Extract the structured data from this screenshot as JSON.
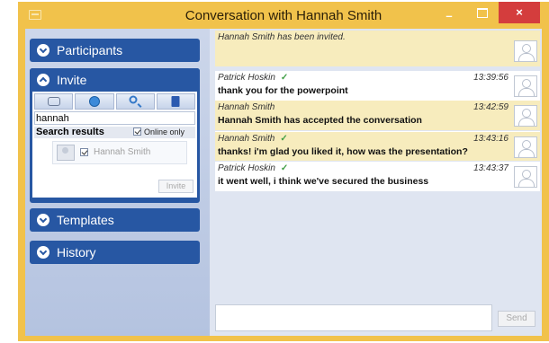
{
  "window": {
    "title": "Conversation with Hannah Smith",
    "minimize": "–",
    "close": "×"
  },
  "sidebar": {
    "participants": "Participants",
    "invite": {
      "title": "Invite",
      "search_value": "hannah",
      "results_label": "Search results",
      "online_only": "Online only",
      "online_only_checked": true,
      "result": {
        "name": "Hannah Smith",
        "checked": true
      },
      "invite_button": "Invite",
      "tools": [
        "people-icon",
        "globe-icon",
        "search-icon",
        "address-book-icon"
      ]
    },
    "templates": "Templates",
    "history": "History"
  },
  "messages": [
    {
      "sender": "",
      "time": "",
      "text": "",
      "invited_text": "Hannah Smith has been invited.",
      "bg": "yellow"
    },
    {
      "sender": "Patrick Hoskin",
      "verified": true,
      "time": "13:39:56",
      "text": "thank you for the powerpoint",
      "bg": "white"
    },
    {
      "sender": "Hannah Smith",
      "verified": false,
      "time": "13:42:59",
      "text": "Hannah Smith has accepted the conversation",
      "bg": "yellow"
    },
    {
      "sender": "Hannah Smith",
      "verified": true,
      "time": "13:43:16",
      "text": "thanks! i'm glad you liked it, how was the presentation?",
      "bg": "yellow"
    },
    {
      "sender": "Patrick Hoskin",
      "verified": true,
      "time": "13:43:37",
      "text": "it went well, i think we've secured the business",
      "bg": "white"
    }
  ],
  "compose": {
    "value": "",
    "send_label": "Send"
  },
  "colors": {
    "title_bar": "#f1c24b",
    "pane_header": "#2757a3",
    "close_button": "#d43d3d",
    "message_highlight": "#f7ecbd"
  }
}
